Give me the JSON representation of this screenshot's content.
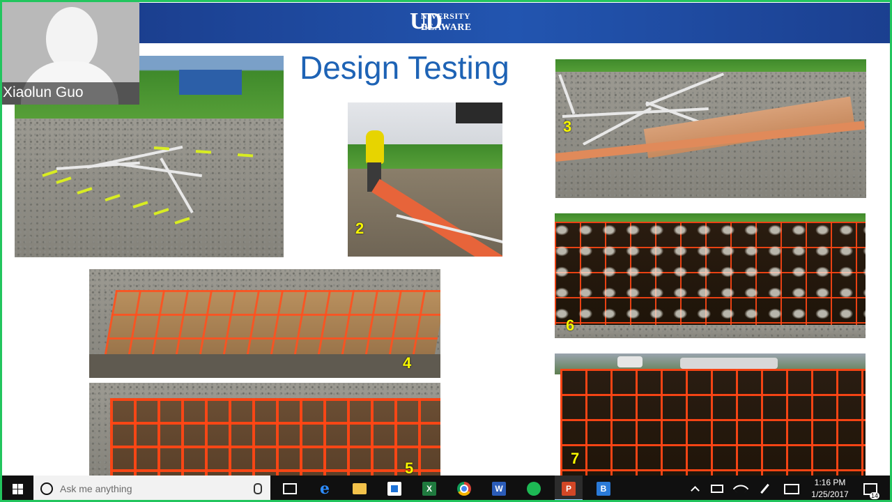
{
  "webcam": {
    "participant_name": "Xiaolun Guo"
  },
  "slide": {
    "title": "Design Testing",
    "logo_text": {
      "ud": "UD",
      "line1": "NIVERSITY OF",
      "line2": "ELAWARE"
    },
    "photo_labels": [
      "2",
      "3",
      "4",
      "5",
      "6",
      "7"
    ]
  },
  "taskbar": {
    "search_placeholder": "Ask me anything",
    "apps": [
      "task-view",
      "edge",
      "file-explorer",
      "store",
      "excel",
      "chrome",
      "word",
      "spotify",
      "powerpoint",
      "bluejeans"
    ],
    "app_glyphs": {
      "excel": "X",
      "word": "W",
      "powerpoint": "P",
      "bluejeans": "B"
    },
    "clock_time": "1:16 PM",
    "clock_date": "1/25/2017",
    "notification_count": "14"
  },
  "colors": {
    "banner": "#1f4ea3",
    "title": "#1e63b5",
    "frame": "#22c55e",
    "label_yellow": "#f7f700"
  }
}
